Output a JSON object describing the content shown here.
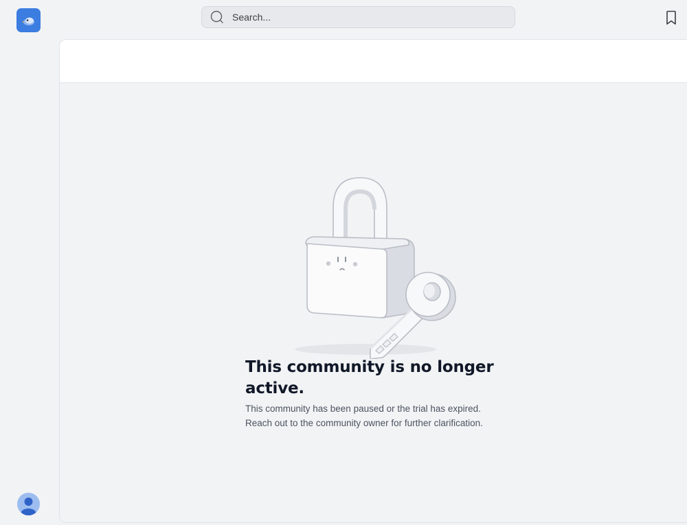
{
  "app": {
    "logo_icon": "bird-logo-icon",
    "accent": "#3b7de0"
  },
  "search": {
    "placeholder": "Search...",
    "icon": "search-icon"
  },
  "header": {
    "bookmark_icon": "bookmark-icon"
  },
  "user": {
    "avatar_icon": "user-avatar-icon"
  },
  "main": {
    "illustration": "padlock-and-key-icon",
    "title": "This community is no longer active.",
    "description_line1": "This community has been paused or the trial has expired.",
    "description_line2": "Reach out to the community owner for further clarification."
  },
  "colors": {
    "background": "#f2f3f5",
    "panel_header": "#ffffff",
    "title_text": "#101828",
    "body_text": "#4b5260"
  }
}
